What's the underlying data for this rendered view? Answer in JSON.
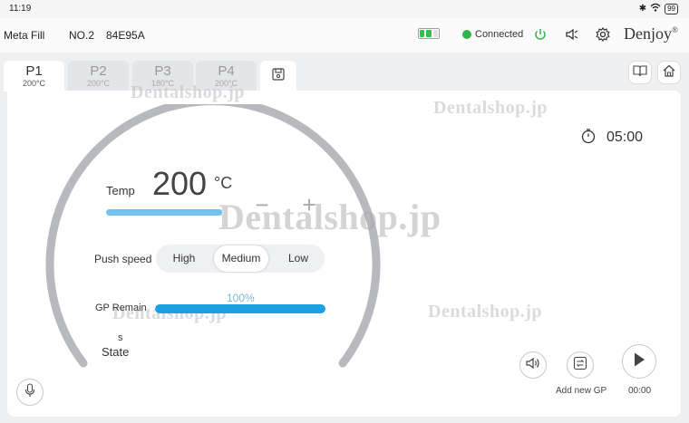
{
  "status_bar": {
    "time": "11:19",
    "battery_level": "99"
  },
  "header": {
    "app_name": "Meta Fill",
    "device_no": "NO.2",
    "device_id": "84E95A",
    "connection": "Connected",
    "brand": "Denjoy",
    "brand_mark": "®",
    "battery_bars_filled": 2,
    "battery_bars_total": 3,
    "accent_green": "#2bb64b"
  },
  "tabs": [
    {
      "name": "P1",
      "temp": "200°C",
      "active": true
    },
    {
      "name": "P2",
      "temp": "200°C",
      "active": false
    },
    {
      "name": "P3",
      "temp": "180°C",
      "active": false
    },
    {
      "name": "P4",
      "temp": "200°C",
      "active": false
    }
  ],
  "main": {
    "temp_label": "Temp",
    "temp_value": "200",
    "temp_unit": "°C",
    "minus": "−",
    "plus": "+",
    "push_speed_label": "Push speed",
    "speeds": [
      "High",
      "Medium",
      "Low"
    ],
    "speed_selected": "Medium",
    "gp_remain_label": "GP Remain",
    "gp_remain_pct": "100%",
    "gp_remain_fraction": 1.0,
    "state_unit": "s",
    "state_label": "State",
    "timer": "05:00",
    "add_new_gp": "Add new GP",
    "play_time": "00:00",
    "bar_color": "#1da0e3"
  },
  "watermarks": [
    "Dentalshop.jp",
    "Dentalshop.jp",
    "Dentalshop.jp",
    "Dentalshop.jp",
    "Dentalshop.jp"
  ],
  "icons": [
    "wifi-icon",
    "bluetooth-icon",
    "power-icon",
    "speaker-icon",
    "gear-icon",
    "book-icon",
    "home-icon",
    "save-icon",
    "stopwatch-icon",
    "volume-icon",
    "swap-icon",
    "play-icon",
    "mic-icon"
  ]
}
